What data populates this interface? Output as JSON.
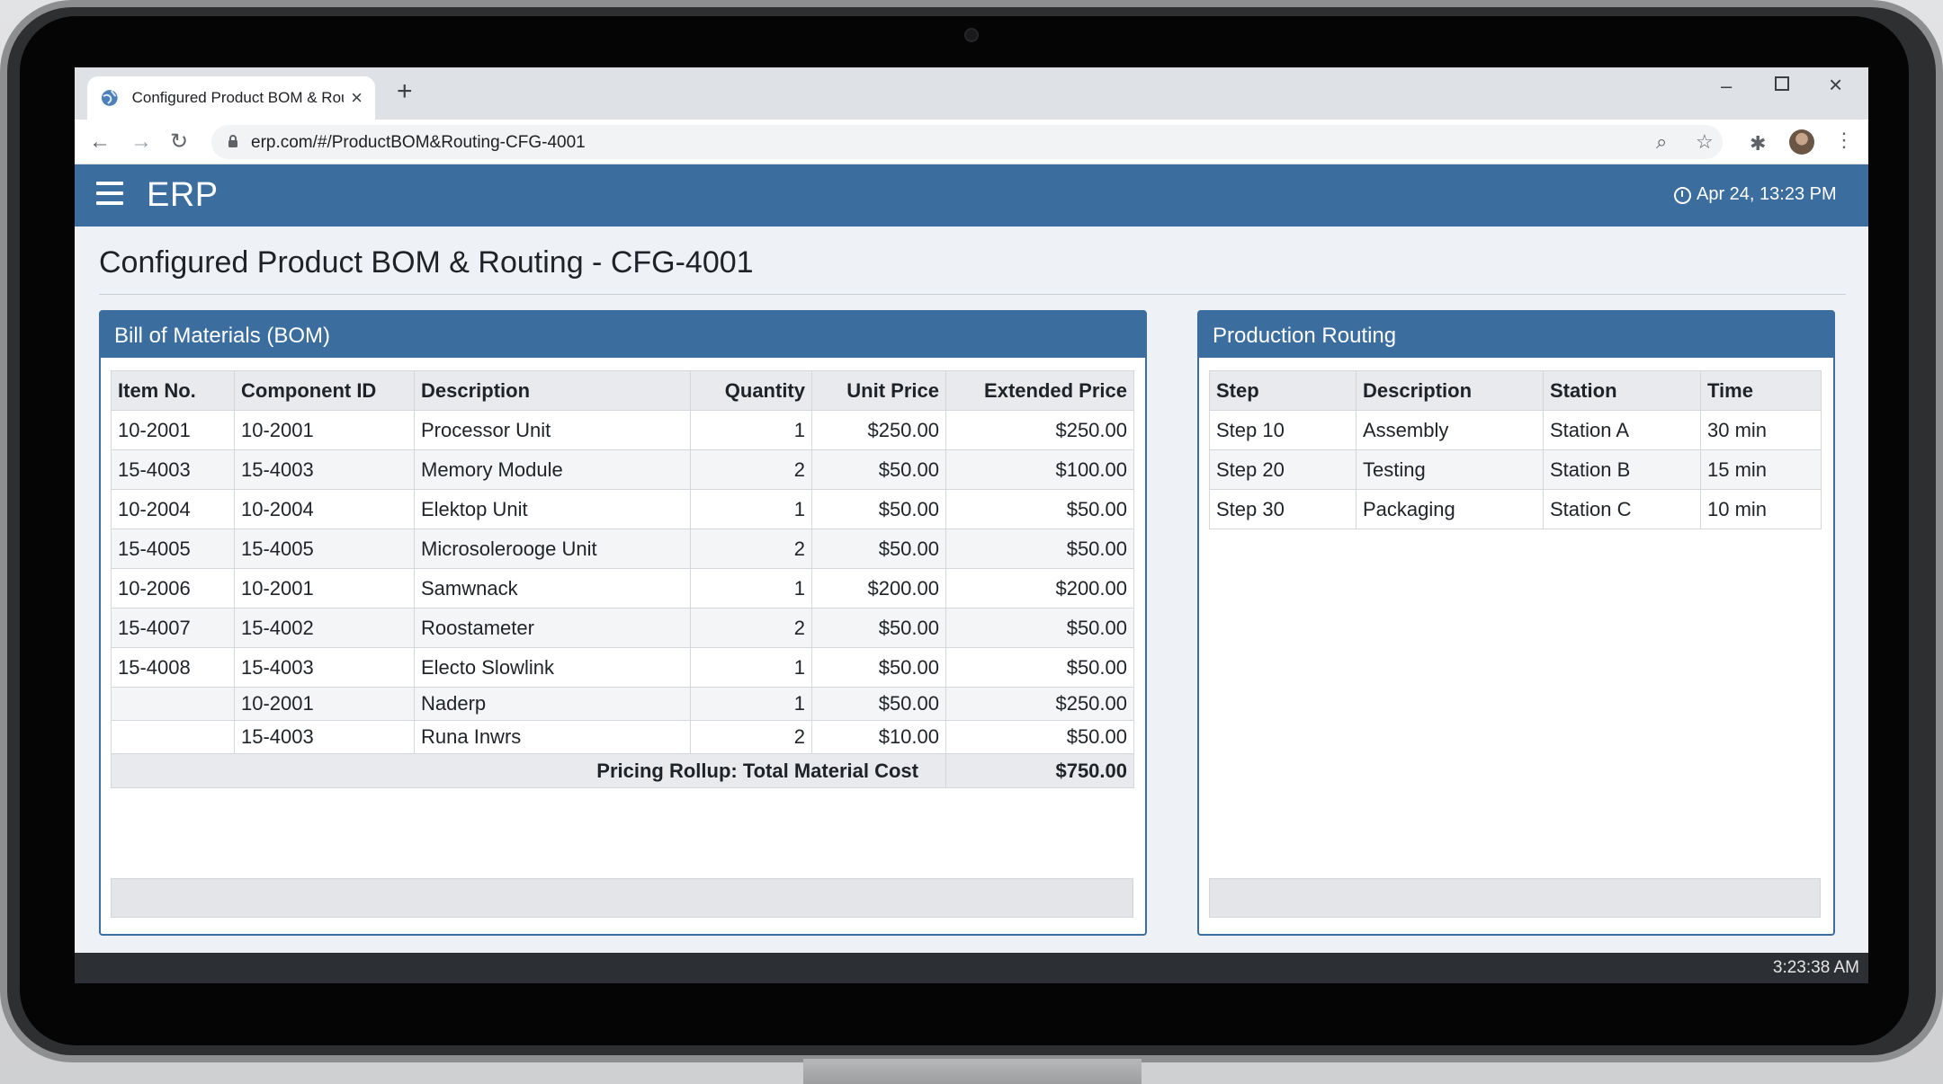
{
  "browser": {
    "tab_title": "Configured Product BOM & Routing - CFG-4001",
    "url": "erp.com/#/ProductBOM&Routing-CFG-4001"
  },
  "app": {
    "name": "ERP",
    "datetime": "Apr 24, 13:23 PM",
    "page_title": "Configured Product BOM & Routing - CFG-4001"
  },
  "bom": {
    "title": "Bill of Materials (BOM)",
    "columns": [
      "Item No.",
      "Component ID",
      "Description",
      "Quantity",
      "Unit Price",
      "Extended Price"
    ],
    "rows": [
      {
        "item": "10-2001",
        "component": "10-2001",
        "description": "Processor Unit",
        "qty": "1",
        "unit": "$250.00",
        "ext": "$250.00"
      },
      {
        "item": "15-4003",
        "component": "15-4003",
        "description": "Memory Module",
        "qty": "2",
        "unit": "$50.00",
        "ext": "$100.00"
      },
      {
        "item": "10-2004",
        "component": "10-2004",
        "description": "Elektop Unit",
        "qty": "1",
        "unit": "$50.00",
        "ext": "$50.00"
      },
      {
        "item": "15-4005",
        "component": "15-4005",
        "description": "Microsolerooge Unit",
        "qty": "2",
        "unit": "$50.00",
        "ext": "$50.00"
      },
      {
        "item": "10-2006",
        "component": "10-2001",
        "description": "Samwnack",
        "qty": "1",
        "unit": "$200.00",
        "ext": "$200.00"
      },
      {
        "item": "15-4007",
        "component": "15-4002",
        "description": "Roostameter",
        "qty": "2",
        "unit": "$50.00",
        "ext": "$50.00"
      },
      {
        "item": "15-4008",
        "component": "15-4003",
        "description": "Electo Slowlink",
        "qty": "1",
        "unit": "$50.00",
        "ext": "$50.00"
      },
      {
        "item": "",
        "component": "10-2001",
        "description": "Naderp",
        "qty": "1",
        "unit": "$50.00",
        "ext": "$250.00"
      },
      {
        "item": "",
        "component": "15-4003",
        "description": "Runa Inwrs",
        "qty": "2",
        "unit": "$10.00",
        "ext": "$50.00"
      }
    ],
    "rollup_label": "Pricing Rollup: Total Material Cost",
    "rollup_value": "$750.00"
  },
  "routing": {
    "title": "Production Routing",
    "columns": [
      "Step",
      "Description",
      "Station",
      "Time"
    ],
    "rows": [
      {
        "step": "Step 10",
        "description": "Assembly",
        "station": "Station A",
        "time": "30 min"
      },
      {
        "step": "Step 20",
        "description": "Testing",
        "station": "Station B",
        "time": "15 min"
      },
      {
        "step": "Step 30",
        "description": "Packaging",
        "station": "Station C",
        "time": "10 min"
      }
    ]
  },
  "taskbar": {
    "time": "3:23:38 AM"
  },
  "icons": [
    "globe-icon",
    "close-icon",
    "plus-icon",
    "back-icon",
    "forward-icon",
    "reload-icon",
    "lock-icon",
    "zoom-icon",
    "star-icon",
    "extensions-icon",
    "avatar",
    "menu-icon",
    "clock-icon"
  ],
  "colors": {
    "header_blue": "#3c6d9f",
    "page_background": "#eef1f5"
  }
}
